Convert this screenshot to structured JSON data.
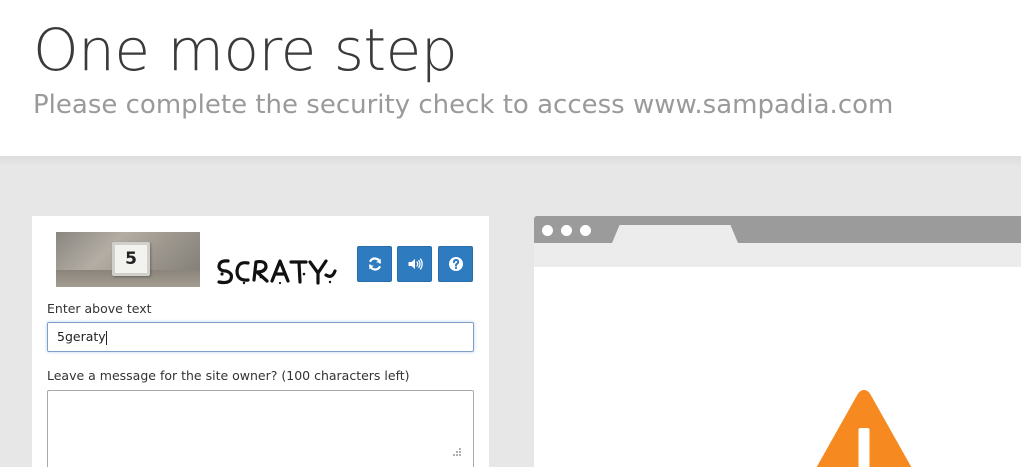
{
  "header": {
    "title": "One more step",
    "subtitle": "Please complete the security check to access www.sampadia.com"
  },
  "captcha": {
    "photo_number": "5",
    "word_image_text": "5CRATY",
    "buttons": {
      "refresh_icon": "refresh-icon",
      "audio_icon": "speaker-icon",
      "help_icon": "question-icon"
    },
    "accent_color": "#2f7bbf"
  },
  "form": {
    "text_label": "Enter above text",
    "text_value": "5geraty",
    "message_label": "Leave a message for the site owner? (100 characters left)",
    "message_value": ""
  },
  "browser_illustration": {
    "bar_color": "#9b9b9b",
    "warning_color": "#f6891f"
  }
}
